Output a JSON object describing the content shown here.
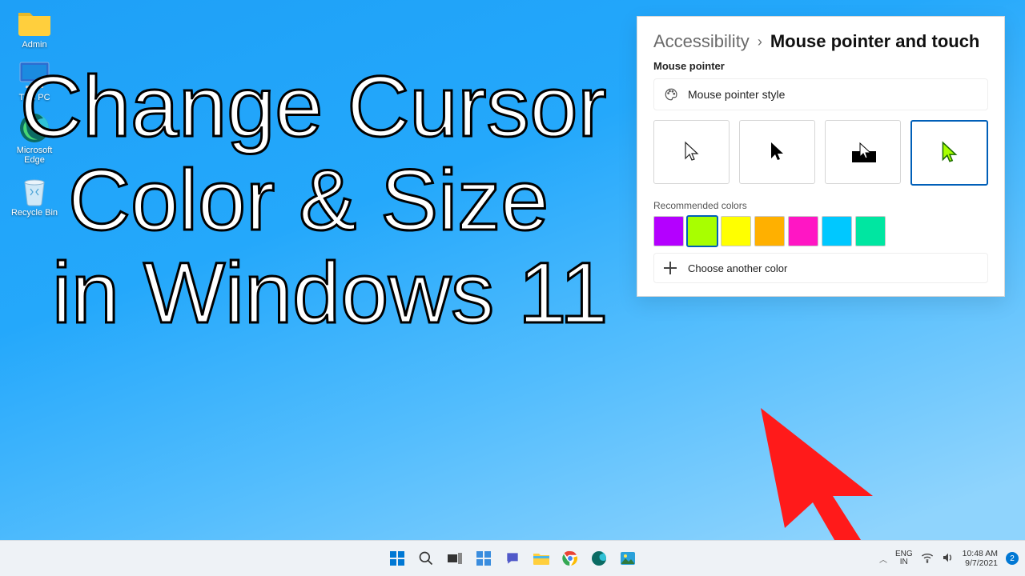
{
  "desktop_icons": [
    {
      "label": "Admin"
    },
    {
      "label": "This PC"
    },
    {
      "label": "Microsoft Edge"
    },
    {
      "label": "Recycle Bin"
    }
  ],
  "headline": {
    "l1": "Change Cursor",
    "l2": "Color & Size",
    "l3": "in Windows 11"
  },
  "panel": {
    "breadcrumb_parent": "Accessibility",
    "breadcrumb_sep": "›",
    "breadcrumb_current": "Mouse pointer and touch",
    "section": "Mouse pointer",
    "style_label": "Mouse pointer style",
    "recommended_label": "Recommended colors",
    "colors": [
      "#b400ff",
      "#a8ff00",
      "#ffff00",
      "#ffb000",
      "#ff16c4",
      "#00c8ff",
      "#00e6a1"
    ],
    "selected_color_index": 1,
    "choose_label": "Choose another color"
  },
  "taskbar": {
    "lang_top": "ENG",
    "lang_bot": "IN",
    "time": "10:48 AM",
    "date": "9/7/2021",
    "notif_count": "2"
  }
}
